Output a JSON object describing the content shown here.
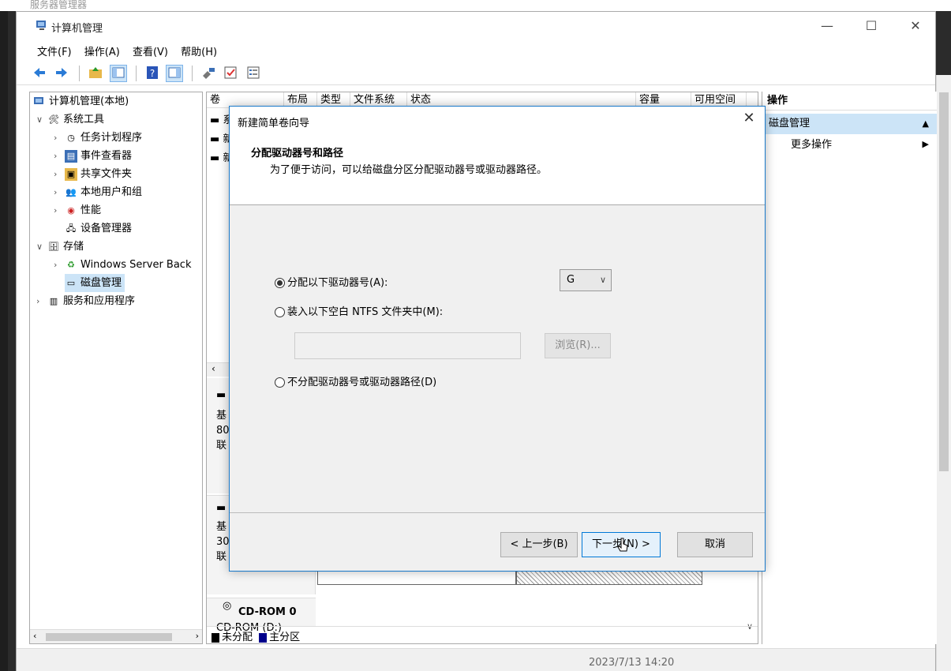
{
  "background": {
    "title": "服务器管理器"
  },
  "window": {
    "title": "计算机管理",
    "controls": {
      "minimize": "—",
      "maximize": "☐",
      "close": "✕"
    }
  },
  "menubar": [
    "文件(F)",
    "操作(A)",
    "查看(V)",
    "帮助(H)"
  ],
  "tree": {
    "root": "计算机管理(本地)",
    "system_tools": "系统工具",
    "task_scheduler": "任务计划程序",
    "event_viewer": "事件查看器",
    "shared_folders": "共享文件夹",
    "local_users": "本地用户和组",
    "performance": "性能",
    "device_manager": "设备管理器",
    "storage": "存储",
    "windows_backup": "Windows Server Back",
    "disk_management": "磁盘管理",
    "services_apps": "服务和应用程序"
  },
  "center": {
    "columns": [
      "卷",
      "布局",
      "类型",
      "文件系统",
      "状态",
      "容量",
      "可用空间"
    ],
    "volume_rows": [
      "▬ 系",
      "▬ 新",
      "▬ 新"
    ],
    "disk1": {
      "line1": "基",
      "line2": "80",
      "line3": "联"
    },
    "disk2": {
      "line1": "基",
      "line2": "30",
      "line3": "联"
    },
    "cdrom": {
      "name": "CD-ROM 0",
      "label": "CD-ROM (D:)"
    },
    "legend": {
      "unallocated": "未分配",
      "primary": "主分区"
    }
  },
  "actions": {
    "header": "操作",
    "selected": "磁盘管理",
    "more": "更多操作"
  },
  "statusbar": {
    "clock": "2023/7/13 14:20"
  },
  "dialog": {
    "title": "新建简单卷向导",
    "heading": "分配驱动器号和路径",
    "description": "为了便于访问，可以给磁盘分区分配驱动器号或驱动器路径。",
    "option_assign": "分配以下驱动器号(A):",
    "option_mount": "装入以下空白 NTFS 文件夹中(M):",
    "option_none": "不分配驱动器号或驱动器路径(D)",
    "drive_letter": "G",
    "browse": "浏览(R)...",
    "back": "< 上一步(B)",
    "next": "下一步(N) >",
    "cancel": "取消"
  },
  "colors": {
    "accent": "#1979ca",
    "selection": "#cce4f7",
    "primary_partition": "#00008b",
    "unallocated": "#000000"
  }
}
